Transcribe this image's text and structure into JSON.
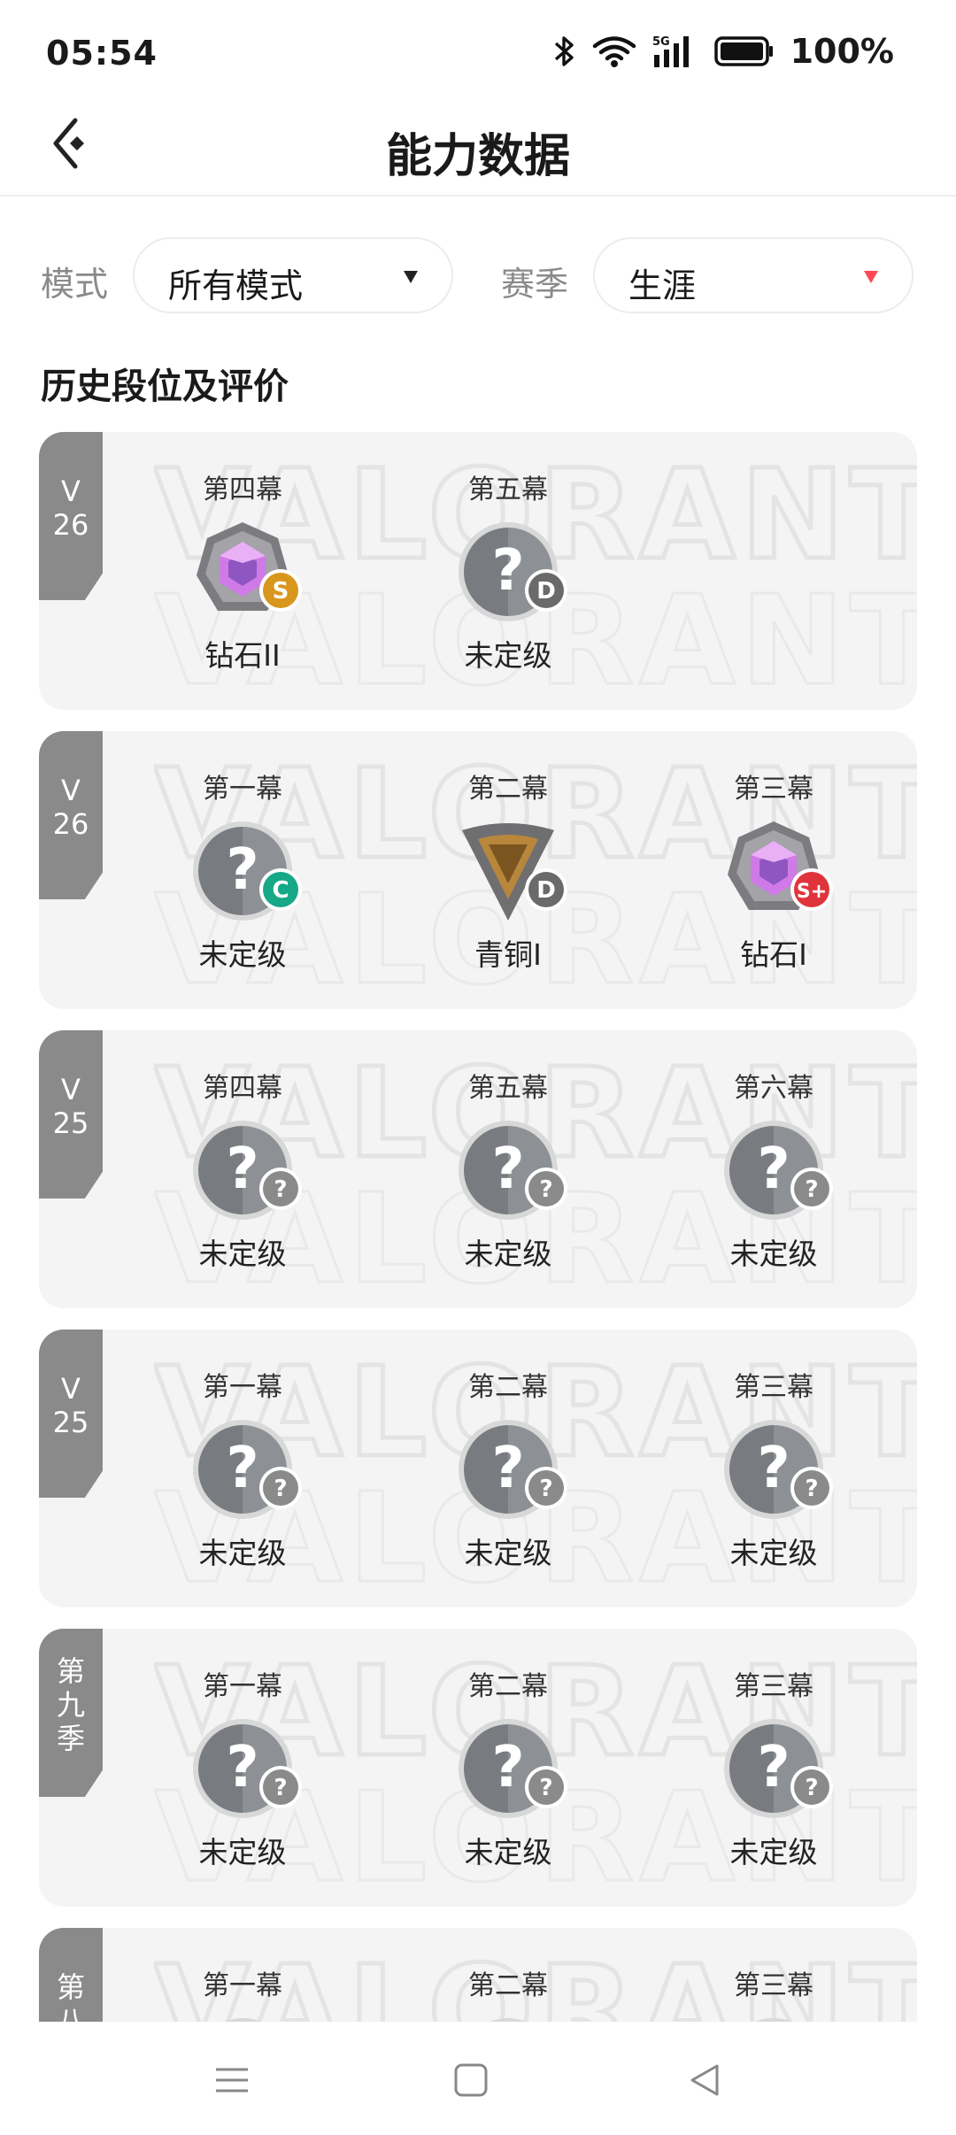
{
  "status_bar": {
    "time": "05:54",
    "battery": "100%",
    "network": "5G"
  },
  "header": {
    "title": "能力数据"
  },
  "filters": {
    "mode_label": "模式",
    "mode_value": "所有模式",
    "season_label": "赛季",
    "season_value": "生涯"
  },
  "section_title": "历史段位及评价",
  "cards": [
    {
      "tag": [
        "V",
        "26"
      ],
      "acts": [
        {
          "name": "第四幕",
          "rank": "钻石II",
          "emblem": "diamond",
          "grade": "S",
          "grade_color": "#d9961c"
        },
        {
          "name": "第五幕",
          "rank": "未定级",
          "emblem": "unrated",
          "grade": "D",
          "grade_color": "#6a6a6a"
        }
      ]
    },
    {
      "tag": [
        "V",
        "26"
      ],
      "acts": [
        {
          "name": "第一幕",
          "rank": "未定级",
          "emblem": "unrated",
          "grade": "C",
          "grade_color": "#17a888"
        },
        {
          "name": "第二幕",
          "rank": "青铜I",
          "emblem": "bronze",
          "grade": "D",
          "grade_color": "#6a6a6a"
        },
        {
          "name": "第三幕",
          "rank": "钻石I",
          "emblem": "diamond",
          "grade": "S+",
          "grade_color": "#e0343c"
        }
      ]
    },
    {
      "tag": [
        "V",
        "25"
      ],
      "acts": [
        {
          "name": "第四幕",
          "rank": "未定级",
          "emblem": "unrated",
          "grade": "?",
          "grade_color": "#8a8a8a"
        },
        {
          "name": "第五幕",
          "rank": "未定级",
          "emblem": "unrated",
          "grade": "?",
          "grade_color": "#8a8a8a"
        },
        {
          "name": "第六幕",
          "rank": "未定级",
          "emblem": "unrated",
          "grade": "?",
          "grade_color": "#8a8a8a"
        }
      ]
    },
    {
      "tag": [
        "V",
        "25"
      ],
      "acts": [
        {
          "name": "第一幕",
          "rank": "未定级",
          "emblem": "unrated",
          "grade": "?",
          "grade_color": "#8a8a8a"
        },
        {
          "name": "第二幕",
          "rank": "未定级",
          "emblem": "unrated",
          "grade": "?",
          "grade_color": "#8a8a8a"
        },
        {
          "name": "第三幕",
          "rank": "未定级",
          "emblem": "unrated",
          "grade": "?",
          "grade_color": "#8a8a8a"
        }
      ]
    },
    {
      "tag": [
        "第",
        "九",
        "季"
      ],
      "acts": [
        {
          "name": "第一幕",
          "rank": "未定级",
          "emblem": "unrated",
          "grade": "?",
          "grade_color": "#8a8a8a"
        },
        {
          "name": "第二幕",
          "rank": "未定级",
          "emblem": "unrated",
          "grade": "?",
          "grade_color": "#8a8a8a"
        },
        {
          "name": "第三幕",
          "rank": "未定级",
          "emblem": "unrated",
          "grade": "?",
          "grade_color": "#8a8a8a"
        }
      ]
    },
    {
      "tag": [
        "第",
        "八"
      ],
      "acts": [
        {
          "name": "第一幕",
          "rank": "",
          "emblem": "unrated",
          "grade": "?",
          "grade_color": "#8a8a8a"
        },
        {
          "name": "第二幕",
          "rank": "",
          "emblem": "unrated",
          "grade": "?",
          "grade_color": "#8a8a8a"
        },
        {
          "name": "第三幕",
          "rank": "",
          "emblem": "unrated",
          "grade": "?",
          "grade_color": "#8a8a8a"
        }
      ]
    }
  ],
  "watermark_text": "VALORANT",
  "nav": {
    "menu_icon": "menu-icon",
    "home_icon": "home-icon",
    "back_icon": "back-triangle-icon"
  }
}
